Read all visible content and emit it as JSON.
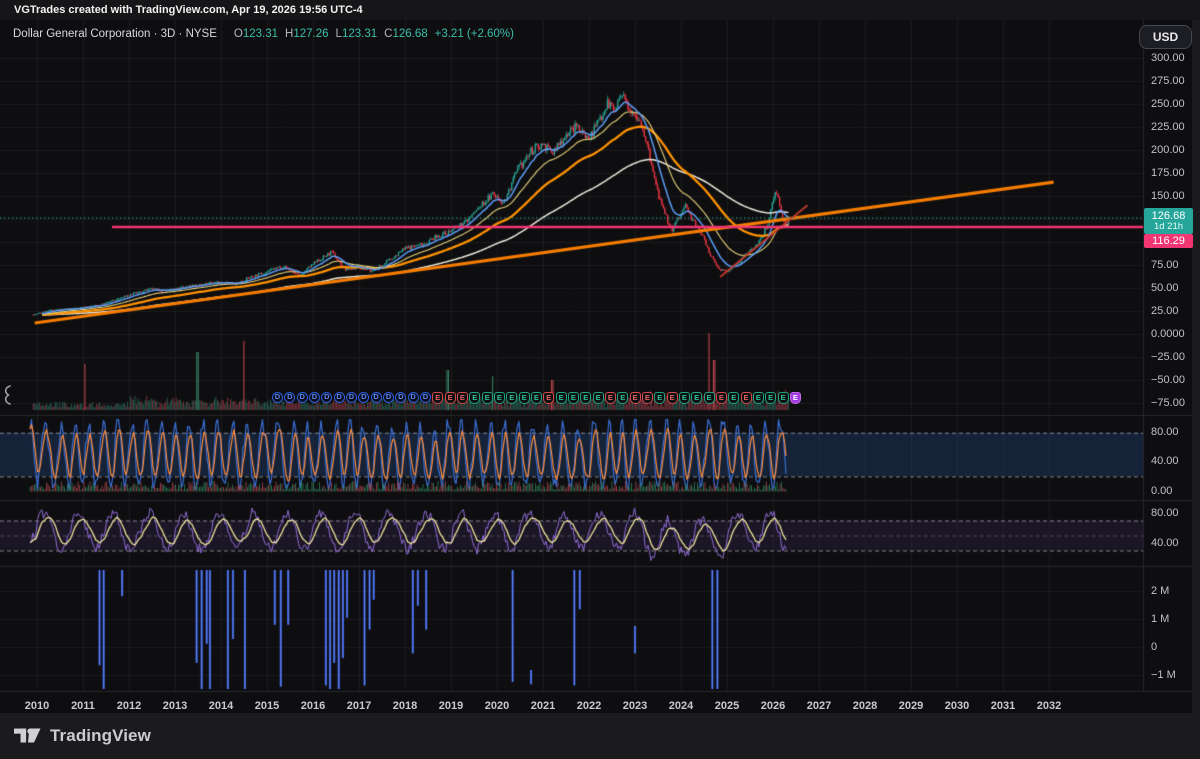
{
  "topbar": {
    "attribution": "VGTrades created with TradingView.com, Apr 19, 2026 19:56 UTC-4"
  },
  "legend": {
    "title": "Dollar General Corporation · 3D · NYSE",
    "ohlc": [
      {
        "k": "O",
        "v": "123.31"
      },
      {
        "k": "H",
        "v": "127.26"
      },
      {
        "k": "L",
        "v": "123.31"
      },
      {
        "k": "C",
        "v": "126.68"
      }
    ],
    "change": "+3.21 (+2.60%)"
  },
  "price_axis": {
    "currency": "USD",
    "ticks": [
      "300.00",
      "275.00",
      "250.00",
      "225.00",
      "200.00",
      "175.00",
      "150.00",
      "75.00",
      "50.00",
      "25.00",
      "0.0000",
      "−25.00",
      "−50.00",
      "−75.00"
    ],
    "last_price": "126.68",
    "countdown": "1d 21h",
    "alert_price": "116.29"
  },
  "stoch_pane": {
    "ticks": [
      "80.00",
      "40.00",
      "0.00"
    ]
  },
  "rsi_pane": {
    "ticks": [
      "80.00",
      "40.00"
    ]
  },
  "volume_pane": {
    "ticks": [
      {
        "label": "2 M",
        "v": 2
      },
      {
        "label": "1 M",
        "v": 1
      },
      {
        "label": "0",
        "v": 0
      },
      {
        "label": "−1 M",
        "v": -1
      }
    ]
  },
  "time_axis": {
    "years": [
      "2010",
      "2011",
      "2012",
      "2013",
      "2014",
      "2015",
      "2016",
      "2017",
      "2018",
      "2019",
      "2020",
      "2021",
      "2022",
      "2023",
      "2024",
      "2025",
      "2026",
      "2027",
      "2028",
      "2029",
      "2030",
      "2031",
      "2032"
    ]
  },
  "footer": {
    "brand": "TradingView"
  },
  "chart_data": {
    "type": "candlestick",
    "title": "Dollar General Corporation",
    "timeframe": "3D",
    "exchange": "NYSE",
    "last_bar": {
      "open": 123.31,
      "high": 127.26,
      "low": 123.31,
      "close": 126.68,
      "change": "+3.21 (+2.60%)"
    },
    "x_range": [
      2009.9,
      2032.2
    ],
    "price_axis_range_visible": [
      -75,
      310
    ],
    "close_path": [
      [
        2009.92,
        21
      ],
      [
        2010.3,
        26
      ],
      [
        2010.6,
        27
      ],
      [
        2011.0,
        29
      ],
      [
        2011.4,
        32
      ],
      [
        2011.75,
        38
      ],
      [
        2012.1,
        44
      ],
      [
        2012.5,
        49
      ],
      [
        2012.8,
        47
      ],
      [
        2013.1,
        50
      ],
      [
        2013.45,
        53
      ],
      [
        2013.7,
        55
      ],
      [
        2014.0,
        57
      ],
      [
        2014.3,
        54
      ],
      [
        2014.6,
        61
      ],
      [
        2015.0,
        68
      ],
      [
        2015.35,
        74
      ],
      [
        2015.7,
        63
      ],
      [
        2016.0,
        76
      ],
      [
        2016.4,
        89
      ],
      [
        2016.7,
        70
      ],
      [
        2017.0,
        73
      ],
      [
        2017.3,
        68
      ],
      [
        2017.6,
        78
      ],
      [
        2018.0,
        93
      ],
      [
        2018.4,
        98
      ],
      [
        2018.7,
        106
      ],
      [
        2019.0,
        112
      ],
      [
        2019.3,
        121
      ],
      [
        2019.6,
        137
      ],
      [
        2019.9,
        152
      ],
      [
        2020.15,
        143
      ],
      [
        2020.45,
        178
      ],
      [
        2020.75,
        199
      ],
      [
        2021.0,
        207
      ],
      [
        2021.2,
        196
      ],
      [
        2021.5,
        217
      ],
      [
        2021.75,
        226
      ],
      [
        2022.0,
        212
      ],
      [
        2022.2,
        231
      ],
      [
        2022.4,
        252
      ],
      [
        2022.55,
        243
      ],
      [
        2022.7,
        258
      ],
      [
        2022.85,
        249
      ],
      [
        2023.0,
        241
      ],
      [
        2023.15,
        228
      ],
      [
        2023.3,
        196
      ],
      [
        2023.45,
        163
      ],
      [
        2023.6,
        135
      ],
      [
        2023.8,
        113
      ],
      [
        2023.95,
        126
      ],
      [
        2024.1,
        140
      ],
      [
        2024.25,
        123
      ],
      [
        2024.4,
        113
      ],
      [
        2024.55,
        98
      ],
      [
        2024.65,
        84
      ],
      [
        2024.8,
        72
      ],
      [
        2025.0,
        67
      ],
      [
        2025.15,
        74
      ],
      [
        2025.3,
        80
      ],
      [
        2025.45,
        88
      ],
      [
        2025.6,
        95
      ],
      [
        2025.75,
        104
      ],
      [
        2025.9,
        122
      ],
      [
        2026.0,
        147
      ],
      [
        2026.07,
        158
      ],
      [
        2026.15,
        139
      ],
      [
        2026.22,
        121
      ],
      [
        2026.28,
        116
      ],
      [
        2026.35,
        126.68
      ]
    ],
    "moving_averages": [
      {
        "name": "fast",
        "color": "#5b9cf6",
        "period_bars": 12
      },
      {
        "name": "medium",
        "color": "#e8d27a",
        "period_bars": 30
      },
      {
        "name": "slow",
        "color": "#ff9100",
        "period_bars": 65
      },
      {
        "name": "slowest",
        "color": "#ece7da",
        "period_bars": 150
      }
    ],
    "trendlines": [
      {
        "name": "long-term-uptrend",
        "color": "#f57c00",
        "width": 3.2,
        "from": [
          2009.95,
          12
        ],
        "to": [
          2032.1,
          165
        ]
      },
      {
        "name": "recovery-trendline",
        "color": "#c0392b",
        "width": 1.8,
        "from": [
          2024.85,
          62
        ],
        "to": [
          2026.75,
          140
        ]
      }
    ],
    "horizontal_lines": [
      {
        "name": "current-price-line",
        "value": 126.68,
        "style": "dotted",
        "color": "#2ea390",
        "from_year": "left-edge"
      },
      {
        "name": "support-line",
        "value": 116.29,
        "style": "solid",
        "color": "#f23674",
        "from_year": 2011.63
      }
    ],
    "event_badges": [
      {
        "k": "D",
        "c": "blue"
      },
      {
        "k": "D",
        "c": "blue"
      },
      {
        "k": "D",
        "c": "blue"
      },
      {
        "k": "D",
        "c": "blue"
      },
      {
        "k": "D",
        "c": "blue"
      },
      {
        "k": "D",
        "c": "blue"
      },
      {
        "k": "D",
        "c": "blue"
      },
      {
        "k": "D",
        "c": "blue"
      },
      {
        "k": "D",
        "c": "blue"
      },
      {
        "k": "D",
        "c": "blue"
      },
      {
        "k": "D",
        "c": "blue"
      },
      {
        "k": "D",
        "c": "blue"
      },
      {
        "k": "D",
        "c": "blue"
      },
      {
        "k": "E",
        "c": "red"
      },
      {
        "k": "E",
        "c": "red"
      },
      {
        "k": "E",
        "c": "red"
      },
      {
        "k": "E",
        "c": "green"
      },
      {
        "k": "E",
        "c": "green"
      },
      {
        "k": "E",
        "c": "green"
      },
      {
        "k": "E",
        "c": "green"
      },
      {
        "k": "E",
        "c": "green"
      },
      {
        "k": "E",
        "c": "green"
      },
      {
        "k": "E",
        "c": "red"
      },
      {
        "k": "E",
        "c": "green"
      },
      {
        "k": "E",
        "c": "green"
      },
      {
        "k": "E",
        "c": "green"
      },
      {
        "k": "E",
        "c": "green"
      },
      {
        "k": "E",
        "c": "red"
      },
      {
        "k": "E",
        "c": "green"
      },
      {
        "k": "E",
        "c": "red"
      },
      {
        "k": "E",
        "c": "red"
      },
      {
        "k": "E",
        "c": "green"
      },
      {
        "k": "E",
        "c": "red"
      },
      {
        "k": "E",
        "c": "green"
      },
      {
        "k": "E",
        "c": "green"
      },
      {
        "k": "E",
        "c": "green"
      },
      {
        "k": "E",
        "c": "red"
      },
      {
        "k": "E",
        "c": "green"
      },
      {
        "k": "E",
        "c": "red"
      },
      {
        "k": "E",
        "c": "green"
      },
      {
        "k": "E",
        "c": "green"
      },
      {
        "k": "E",
        "c": "green"
      },
      {
        "k": "E",
        "c": "purple"
      }
    ],
    "volume_overlay": {
      "up_color": "#2f6b5c",
      "down_color": "#8a3a42",
      "spikes": [
        [
          2011.05,
          46,
          "dn"
        ],
        [
          2013.49,
          58,
          "up"
        ],
        [
          2014.5,
          69,
          "dn"
        ],
        [
          2018.93,
          40,
          "up"
        ],
        [
          2019.9,
          34,
          "up"
        ],
        [
          2021.2,
          30,
          "dn"
        ],
        [
          2024.62,
          77,
          "dn"
        ],
        [
          2024.72,
          50,
          "dn"
        ]
      ]
    },
    "panes": [
      {
        "name": "stochastic",
        "range": [
          0,
          100
        ],
        "bands": [
          80,
          20
        ],
        "lines": [
          {
            "name": "%K",
            "color": "#3b6fd6"
          },
          {
            "name": "%D",
            "color": "#ff8c3a"
          }
        ]
      },
      {
        "name": "rsi",
        "range": [
          0,
          100
        ],
        "bands": [
          70,
          50,
          30
        ],
        "lines": [
          {
            "name": "rsi",
            "color": "#8e6bd4"
          },
          {
            "name": "rsi-ma",
            "color": "#ece29b"
          }
        ]
      },
      {
        "name": "volume-histogram",
        "color": "#3a5fe0",
        "axis": [
          "2 M",
          "1 M",
          "0",
          "−1 M"
        ]
      }
    ],
    "bottom_histogram_bars": [
      {
        "y": 2011.36,
        "s": 0,
        "d": 0.8
      },
      {
        "y": 2011.45,
        "s": 0,
        "d": 1.0
      },
      {
        "y": 2011.85,
        "s": 0,
        "d": 0.22
      },
      {
        "y": 2013.47,
        "s": 0,
        "d": 0.78
      },
      {
        "y": 2013.58,
        "s": 0,
        "d": 1.0
      },
      {
        "y": 2013.69,
        "s": 0,
        "d": 0.62
      },
      {
        "y": 2013.76,
        "s": 0,
        "d": 1.0
      },
      {
        "y": 2014.15,
        "s": 0,
        "d": 1.0
      },
      {
        "y": 2014.26,
        "s": 0,
        "d": 0.58
      },
      {
        "y": 2014.52,
        "s": 0,
        "d": 1.0
      },
      {
        "y": 2015.17,
        "s": 0,
        "d": 0.46
      },
      {
        "y": 2015.3,
        "s": 0,
        "d": 0.98
      },
      {
        "y": 2015.46,
        "s": 0,
        "d": 0.46
      },
      {
        "y": 2016.28,
        "s": 0,
        "d": 0.97
      },
      {
        "y": 2016.37,
        "s": 0,
        "d": 1.0
      },
      {
        "y": 2016.46,
        "s": 0,
        "d": 0.78
      },
      {
        "y": 2016.56,
        "s": 0,
        "d": 1.0
      },
      {
        "y": 2016.65,
        "s": 0,
        "d": 0.74
      },
      {
        "y": 2016.74,
        "s": 0,
        "d": 0.4
      },
      {
        "y": 2017.12,
        "s": 0,
        "d": 0.97
      },
      {
        "y": 2017.23,
        "s": 0,
        "d": 0.5
      },
      {
        "y": 2017.32,
        "s": 0,
        "d": 0.25
      },
      {
        "y": 2018.17,
        "s": 0,
        "d": 0.7
      },
      {
        "y": 2018.28,
        "s": 0,
        "d": 0.3
      },
      {
        "y": 2018.46,
        "s": 0,
        "d": 0.5
      },
      {
        "y": 2020.34,
        "s": 0,
        "d": 0.94
      },
      {
        "y": 2020.74,
        "s": 0.84,
        "d": 0.12
      },
      {
        "y": 2021.68,
        "s": 0,
        "d": 0.97
      },
      {
        "y": 2021.8,
        "s": 0,
        "d": 0.33
      },
      {
        "y": 2023.0,
        "s": 0.47,
        "d": 0.23
      },
      {
        "y": 2024.68,
        "s": 0,
        "d": 1.0
      },
      {
        "y": 2024.79,
        "s": 0,
        "d": 1.0
      }
    ]
  }
}
